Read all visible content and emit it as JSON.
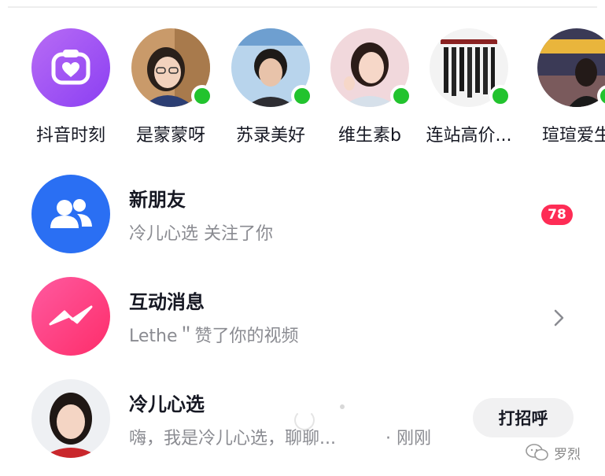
{
  "stories": [
    {
      "name": "抖音时刻",
      "kind": "moments",
      "icon": "camera-heart-icon",
      "online": false
    },
    {
      "name": "是蒙蒙呀",
      "kind": "user",
      "online": true
    },
    {
      "name": "苏录美好",
      "kind": "user",
      "online": true
    },
    {
      "name": "维生素b",
      "kind": "user",
      "online": true
    },
    {
      "name": "连站高价...",
      "kind": "user",
      "online": true
    },
    {
      "name": "瑄瑄爱生",
      "kind": "user",
      "online": true
    }
  ],
  "new_friends": {
    "title": "新朋友",
    "subtitle": "冷儿心选 关注了你",
    "badge": "78",
    "icon": "people-icon"
  },
  "interactions": {
    "title": "互动消息",
    "subtitle": "Lethe＂赞了你的视频",
    "icon": "bolt-message-icon"
  },
  "chat": {
    "title": "冷儿心选",
    "subtitle": "嗨，我是冷儿心选，聊聊...",
    "time": "· 刚刚",
    "button": "打招呼"
  },
  "watermark": {
    "text": "罗烈",
    "icon": "wechat-icon"
  },
  "colors": {
    "accent": "#fe2c55",
    "online": "#22c32e",
    "moments": "#9b4ff3",
    "new_friends": "#2a6ff3",
    "interactions": "#fd3b7b"
  }
}
